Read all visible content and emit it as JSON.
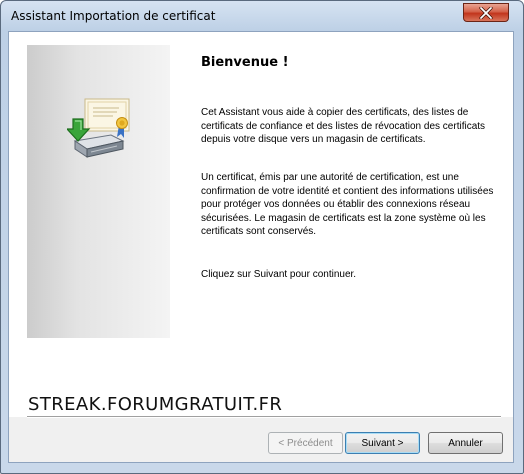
{
  "window": {
    "title": "Assistant Importation de certificat"
  },
  "content": {
    "heading": "Bienvenue !",
    "paragraph1": "Cet Assistant vous aide à copier des certificats, des listes de certificats de confiance et des listes de révocation des certificats depuis votre disque vers un magasin de certificats.",
    "paragraph2": "Un certificat, émis par une autorité de certification, est une confirmation de votre identité et contient des informations utilisées pour protéger vos données ou établir des connexions réseau sécurisées. Le magasin de certificats est la zone système où les certificats sont conservés.",
    "paragraph3": "Cliquez sur Suivant pour continuer.",
    "watermark": "STREAK.FORUMGRATUIT.FR"
  },
  "buttons": {
    "previous_label": "< Précédent",
    "next_label": "Suivant >",
    "cancel_label": "Annuler"
  },
  "icons": {
    "close": "close-icon",
    "wizard": "certificate-import-icon"
  },
  "colors": {
    "close_button": "#c2351c",
    "title_bar": "#bdd0e6",
    "import_arrow": "#3aa53a"
  }
}
